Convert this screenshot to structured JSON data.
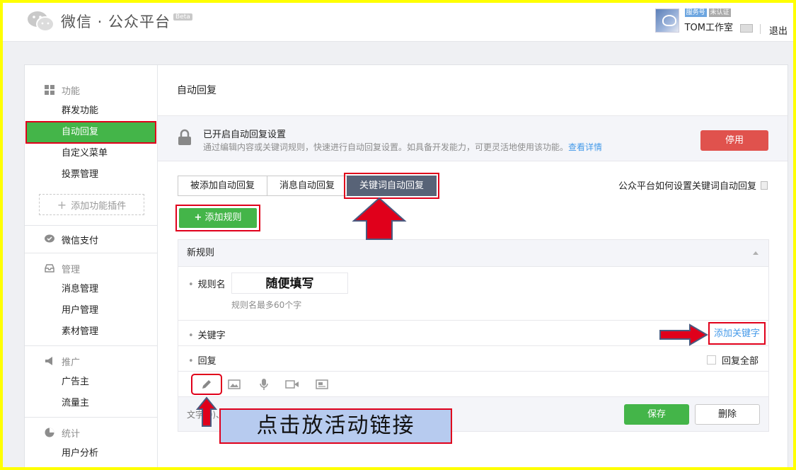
{
  "header": {
    "title": "微信 · 公众平台",
    "beta": "Beta",
    "badge_service": "服务号",
    "badge_unverified": "未认证",
    "account_name": "TOM工作室",
    "logout": "退出"
  },
  "sidebar": {
    "groups": [
      {
        "title": "功能",
        "items": [
          "群发功能",
          "自动回复",
          "自定义菜单",
          "投票管理"
        ],
        "add": "添加功能插件"
      },
      {
        "title": "微信支付"
      },
      {
        "title": "管理",
        "items": [
          "消息管理",
          "用户管理",
          "素材管理"
        ]
      },
      {
        "title": "推广",
        "items": [
          "广告主",
          "流量主"
        ]
      },
      {
        "title": "统计",
        "items": [
          "用户分析"
        ]
      }
    ]
  },
  "main": {
    "breadcrumb": "自动回复",
    "notice_title": "已开启自动回复设置",
    "notice_desc": "通过编辑内容或关键词规则，快速进行自动回复设置。如具备开发能力，可更灵活地使用该功能。",
    "notice_link": "查看详情",
    "stop_label": "停用",
    "tabs": [
      "被添加自动回复",
      "消息自动回复",
      "关键词自动回复"
    ],
    "help_link": "公众平台如何设置关键词自动回复",
    "add_rule": "添加规则",
    "rule": {
      "title": "新规则",
      "name_label": "规则名",
      "name_value": "随便填写",
      "name_hint": "规则名最多60个字",
      "keyword_label": "关键字",
      "add_keyword": "添加关键字",
      "reply_label": "回复",
      "reply_all": "回复全部",
      "footer_text": "文字(0)、图片(0)、语音(0)、视频(0)、图文(0)",
      "save": "保存",
      "delete": "删除"
    }
  },
  "annotation": {
    "callout": "点击放活动链接"
  },
  "colors": {
    "green": "#44b549",
    "red_outline": "#e0001b",
    "danger": "#e0524d",
    "link": "#459ae9",
    "tab_active": "#586377",
    "frame": "#ffff00"
  }
}
